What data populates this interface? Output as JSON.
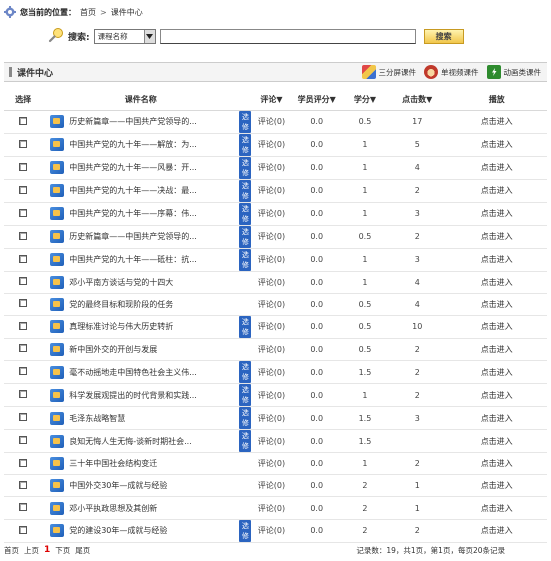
{
  "breadcrumb": {
    "label": "您当前的位置：",
    "home": "首页",
    "separator": ">",
    "current": "课件中心"
  },
  "search": {
    "label": "搜索:",
    "select_value": "课程名称",
    "input_value": "",
    "button_label": "搜索"
  },
  "panel": {
    "title": "课件中心",
    "actions": [
      {
        "label": "三分屏课件",
        "icon": "three-screen-icon",
        "color": "#3a6fd0"
      },
      {
        "label": "单视频课件",
        "icon": "video-icon",
        "color": "#e07a2a"
      },
      {
        "label": "动画类课件",
        "icon": "flash-icon",
        "color": "#3aa03a"
      }
    ]
  },
  "table": {
    "headers": {
      "select": "选择",
      "name": "课件名称",
      "comments": "评论▼",
      "rating": "学员评分▼",
      "credit": "学分▼",
      "clicks": "点击数▼",
      "op": "播放"
    },
    "download_label": "选修",
    "enter_label": "点击进入",
    "rows": [
      {
        "name": "历史新篇章——中国共产党领导的...",
        "comments": "评论(0)",
        "rating": "0.0",
        "credit": "0.5",
        "clicks": "17",
        "has_tag": true
      },
      {
        "name": "中国共产党的九十年——解放：为...",
        "comments": "评论(0)",
        "rating": "0.0",
        "credit": "1",
        "clicks": "5",
        "has_tag": true
      },
      {
        "name": "中国共产党的九十年——风暴：开...",
        "comments": "评论(0)",
        "rating": "0.0",
        "credit": "1",
        "clicks": "4",
        "has_tag": true
      },
      {
        "name": "中国共产党的九十年——决战：最...",
        "comments": "评论(0)",
        "rating": "0.0",
        "credit": "1",
        "clicks": "2",
        "has_tag": true
      },
      {
        "name": "中国共产党的九十年——序幕：伟...",
        "comments": "评论(0)",
        "rating": "0.0",
        "credit": "1",
        "clicks": "3",
        "has_tag": true
      },
      {
        "name": "历史新篇章——中国共产党领导的...",
        "comments": "评论(0)",
        "rating": "0.0",
        "credit": "0.5",
        "clicks": "2",
        "has_tag": true
      },
      {
        "name": "中国共产党的九十年——砥柱：抗...",
        "comments": "评论(0)",
        "rating": "0.0",
        "credit": "1",
        "clicks": "3",
        "has_tag": true
      },
      {
        "name": "邓小平南方谈话与党的十四大",
        "comments": "评论(0)",
        "rating": "0.0",
        "credit": "1",
        "clicks": "4",
        "has_tag": false
      },
      {
        "name": "党的最终目标和现阶段的任务",
        "comments": "评论(0)",
        "rating": "0.0",
        "credit": "0.5",
        "clicks": "4",
        "has_tag": false
      },
      {
        "name": "真理标准讨论与伟大历史转折",
        "comments": "评论(0)",
        "rating": "0.0",
        "credit": "0.5",
        "clicks": "10",
        "has_tag": true
      },
      {
        "name": "新中国外交的开创与发展",
        "comments": "评论(0)",
        "rating": "0.0",
        "credit": "0.5",
        "clicks": "2",
        "has_tag": false
      },
      {
        "name": "毫不动摇地走中国特色社会主义伟...",
        "comments": "评论(0)",
        "rating": "0.0",
        "credit": "1.5",
        "clicks": "2",
        "has_tag": true
      },
      {
        "name": "科学发展观提出的时代背景和实践...",
        "comments": "评论(0)",
        "rating": "0.0",
        "credit": "1",
        "clicks": "2",
        "has_tag": true
      },
      {
        "name": "毛泽东战略智慧",
        "comments": "评论(0)",
        "rating": "0.0",
        "credit": "1.5",
        "clicks": "3",
        "has_tag": true
      },
      {
        "name": "良知无悔人生无悔-谈新时期社会...",
        "comments": "评论(0)",
        "rating": "0.0",
        "credit": "1.5",
        "clicks": "",
        "has_tag": true
      },
      {
        "name": "三十年中国社会结构变迁",
        "comments": "评论(0)",
        "rating": "0.0",
        "credit": "1",
        "clicks": "2",
        "has_tag": false
      },
      {
        "name": "中国外交30年—成就与经验",
        "comments": "评论(0)",
        "rating": "0.0",
        "credit": "2",
        "clicks": "1",
        "has_tag": false
      },
      {
        "name": "邓小平执政思想及其创新",
        "comments": "评论(0)",
        "rating": "0.0",
        "credit": "2",
        "clicks": "1",
        "has_tag": false
      },
      {
        "name": "党的建设30年—成就与经验",
        "comments": "评论(0)",
        "rating": "0.0",
        "credit": "2",
        "clicks": "2",
        "has_tag": true
      }
    ]
  },
  "footer": {
    "first": "首页",
    "prev": "上页",
    "current_page": "1",
    "next": "下页",
    "last": "尾页",
    "stats": "记录数：19，共1页，第1页，每页20条记录"
  }
}
